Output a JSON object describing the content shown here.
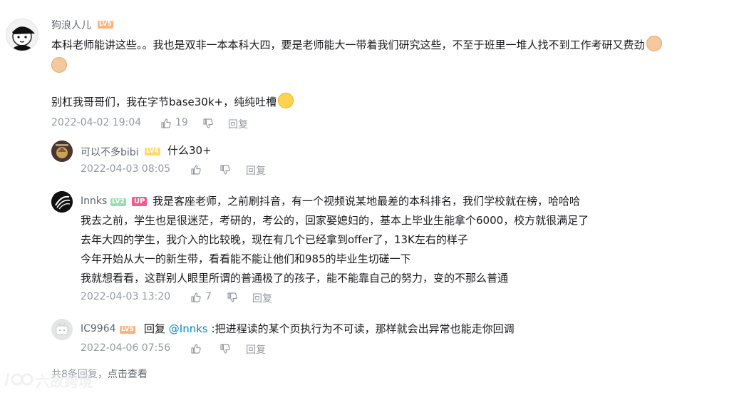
{
  "comment": {
    "username": "狗浪人儿",
    "level": "LV5",
    "line1": "本科老师能讲这些。。我也是双非一本本科大四，要是老师能大一带着我们研究这些，不至于班里一堆人找不到工作考研又费劲",
    "line2": "别杠我哥哥们，我在字节base30k+，纯纯吐槽",
    "time": "2022-04-02 19:04",
    "likes": "19",
    "reply_label": "回复"
  },
  "replies": [
    {
      "username": "可以不多bibi",
      "level": "LV4",
      "text": "什么30+",
      "time": "2022-04-03 08:05",
      "likes": "",
      "reply_label": "回复"
    },
    {
      "username": "Innks",
      "level": "LV2",
      "badge": "UP",
      "lines": [
        "我是客座老师，之前刷抖音，有一个视频说某地最差的本科排名，我们学校就在榜，哈哈哈",
        "我去之前，学生也是很迷茫，考研的，考公的，回家娶媳妇的，基本上毕业生能拿个6000，校方就很满足了",
        "去年大四的学生，我介入的比较晚，现在有几个已经拿到offer了，13K左右的样子",
        "今年开始从大一的新生带，看看能不能让他们和985的毕业生切磋一下",
        "我就想看看，这群别人眼里所谓的普通极了的孩子，能不能靠自己的努力，变的不那么普通"
      ],
      "time": "2022-04-03 13:20",
      "likes": "7",
      "reply_label": "回复"
    },
    {
      "username": "IC9964",
      "level": "LV5",
      "reply_prefix": "回复",
      "mention": "@Innks",
      "text": ":把进程读的某个页执行为不可读，那样就会出异常也能走你回调",
      "time": "2022-04-06 07:56",
      "likes": "",
      "reply_label": "回复"
    }
  ],
  "more_replies": {
    "count_text": "共8条回复，",
    "link_text": "点击查看"
  },
  "watermark": "六故跨境",
  "colors": {
    "text": "#18191c",
    "meta": "#9499a0",
    "username": "#61666d",
    "link": "#008ac5",
    "up_badge": "#f45a8d"
  }
}
